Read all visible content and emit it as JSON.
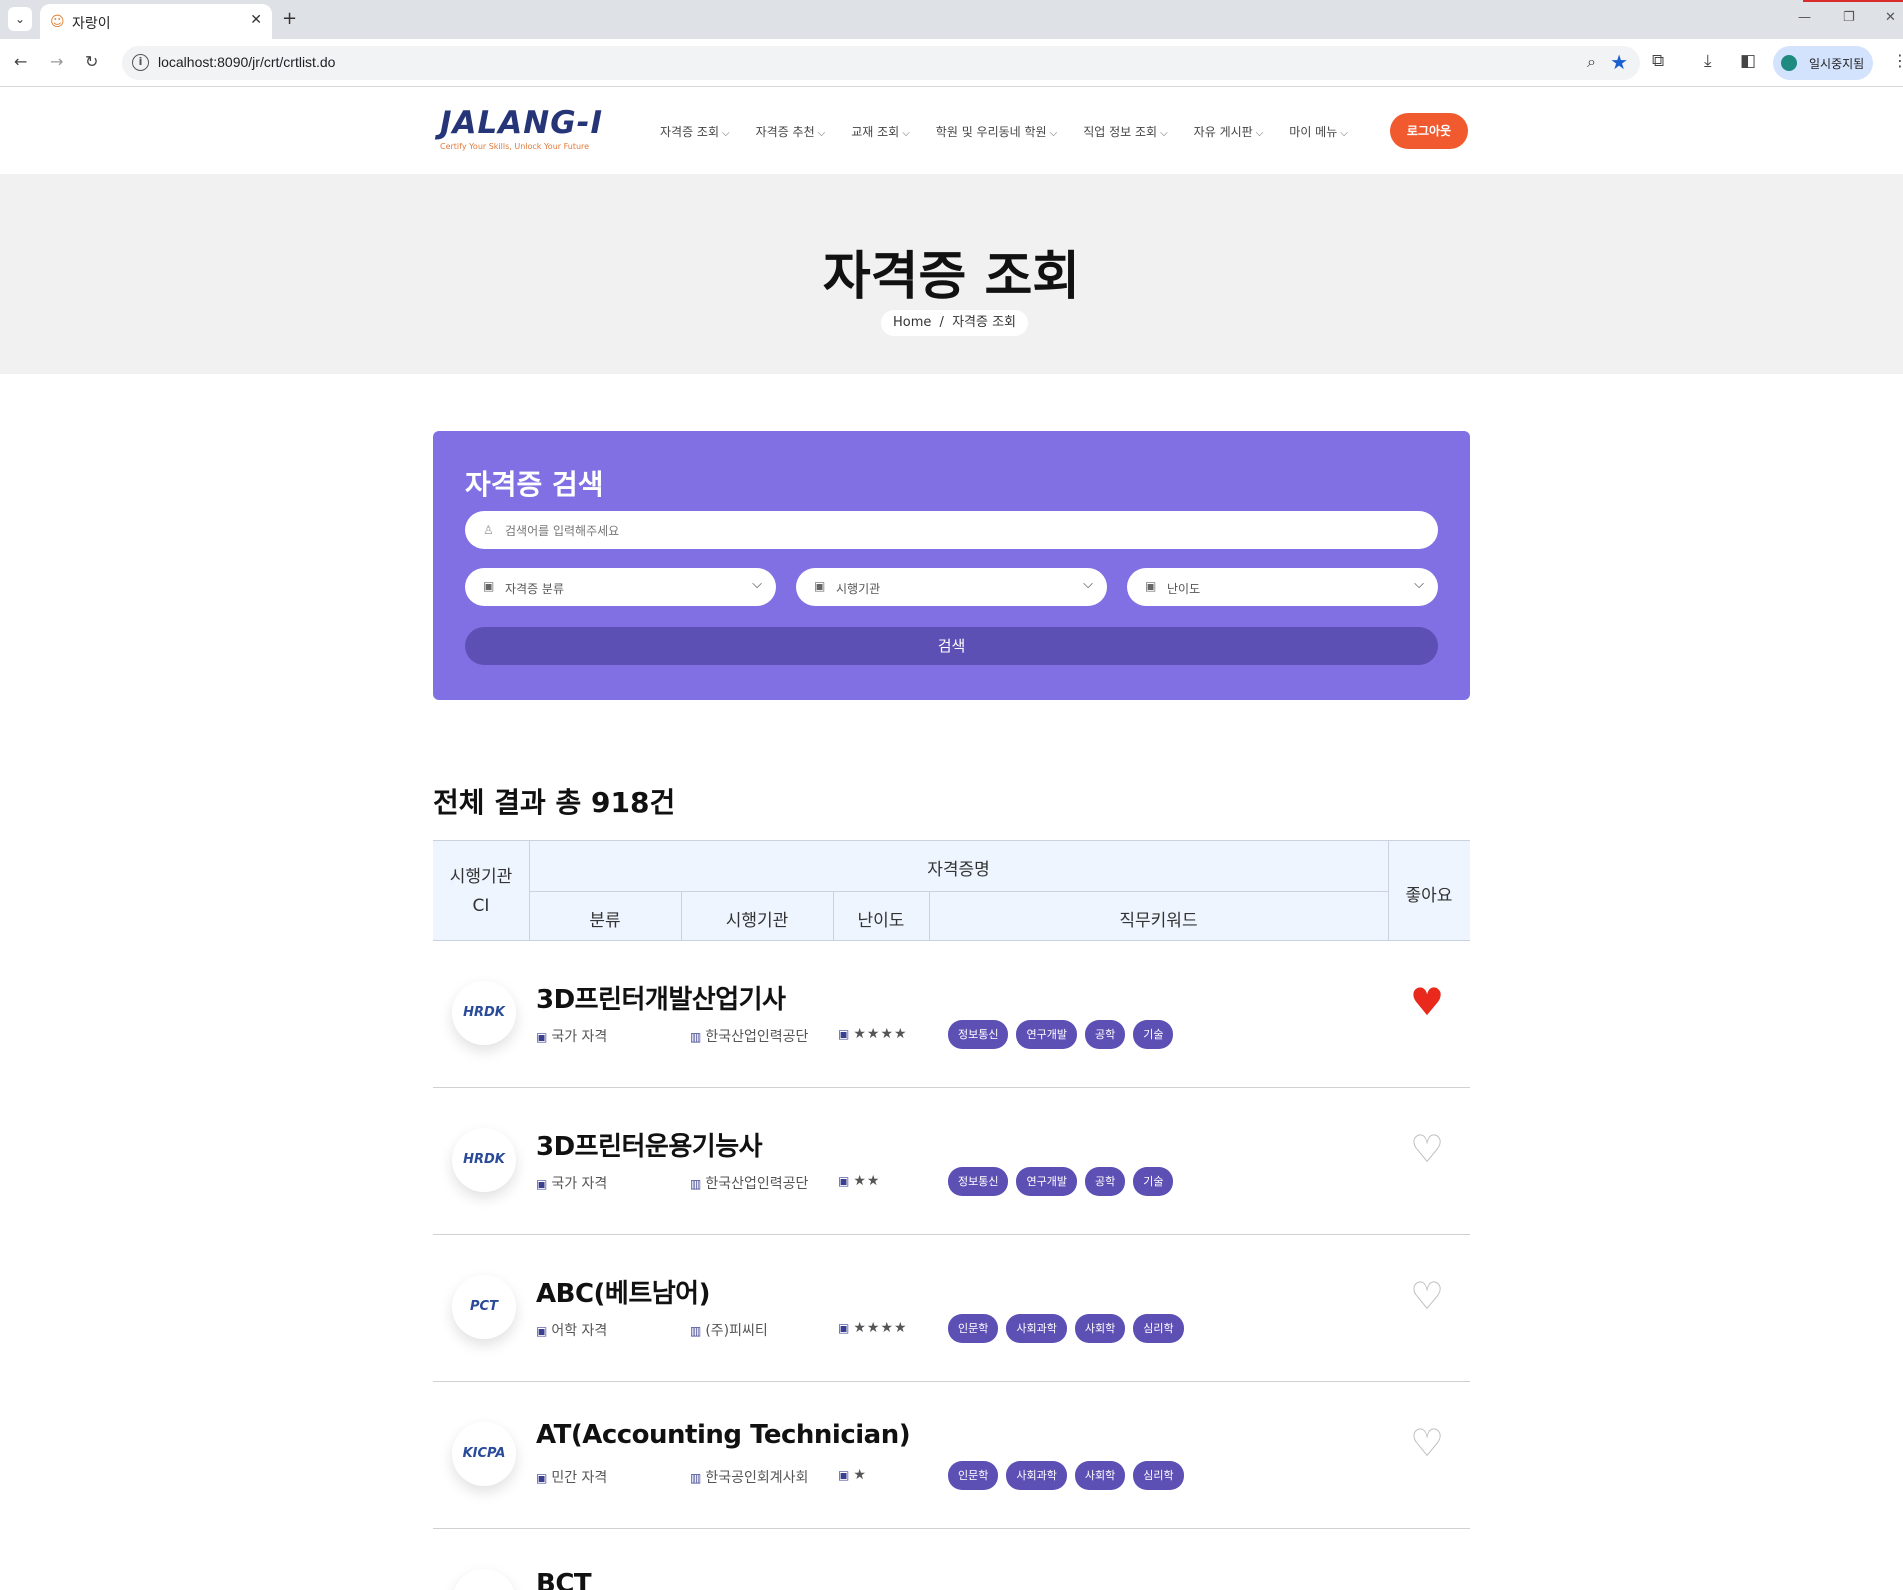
{
  "browser": {
    "tab_title": "자랑이",
    "url": "localhost:8090/jr/crt/crtlist.do",
    "profile_label": "일시중지됨"
  },
  "site": {
    "logo_text": "JALANG-I",
    "logo_tagline": "Certify Your Skills, Unlock Your Future",
    "nav": [
      "자격증 조회",
      "자격증 추천",
      "교재 조회",
      "학원 및 우리동네 학원",
      "직업 정보 조회",
      "자유 게시판",
      "마이 메뉴"
    ],
    "logout_label": "로그아웃"
  },
  "hero": {
    "title": "자격증 조회",
    "breadcrumb_home": "Home",
    "breadcrumb_sep": "/",
    "breadcrumb_current": "자격증 조회"
  },
  "search": {
    "title": "자격증 검색",
    "placeholder": "검색어를 입력해주세요",
    "select_category": "자격증 분류",
    "select_agency": "시행기관",
    "select_difficulty": "난이도",
    "button": "검색"
  },
  "results": {
    "count_label": "전체 결과 총 918건",
    "headers": {
      "ci": "시행기관\nCI",
      "name": "자격증명",
      "category": "분류",
      "agency": "시행기관",
      "difficulty": "난이도",
      "keywords": "직무키워드",
      "like": "좋아요"
    },
    "rows": [
      {
        "logo": "HRDK",
        "title": "3D프린터개발산업기사",
        "category": "국가 자격",
        "agency": "한국산업인력공단",
        "difficulty": "★★★★",
        "keywords": [
          "정보통신",
          "연구개발",
          "공학",
          "기술"
        ],
        "liked": true
      },
      {
        "logo": "HRDK",
        "title": "3D프린터운용기능사",
        "category": "국가 자격",
        "agency": "한국산업인력공단",
        "difficulty": "★★",
        "keywords": [
          "정보통신",
          "연구개발",
          "공학",
          "기술"
        ],
        "liked": false
      },
      {
        "logo": "PCT",
        "title": "ABC(베트남어)",
        "category": "어학 자격",
        "agency": "(주)피씨티",
        "difficulty": "★★★★",
        "keywords": [
          "인문학",
          "사회과학",
          "사회학",
          "심리학"
        ],
        "liked": false
      },
      {
        "logo": "KICPA",
        "title": "AT(Accounting Technician)",
        "category": "민간 자격",
        "agency": "한국공인회계사회",
        "difficulty": "★",
        "keywords": [
          "인문학",
          "사회과학",
          "사회학",
          "심리학"
        ],
        "liked": false
      },
      {
        "logo": "",
        "title": "BCT",
        "category": "",
        "agency": "",
        "difficulty": "",
        "keywords": [],
        "liked": false
      }
    ]
  },
  "colors": {
    "brand_navy": "#263577",
    "accent_orange": "#f05a2e",
    "search_panel": "#8070e3",
    "tag_purple": "#5d50b5",
    "heart_red": "#e8291c"
  }
}
